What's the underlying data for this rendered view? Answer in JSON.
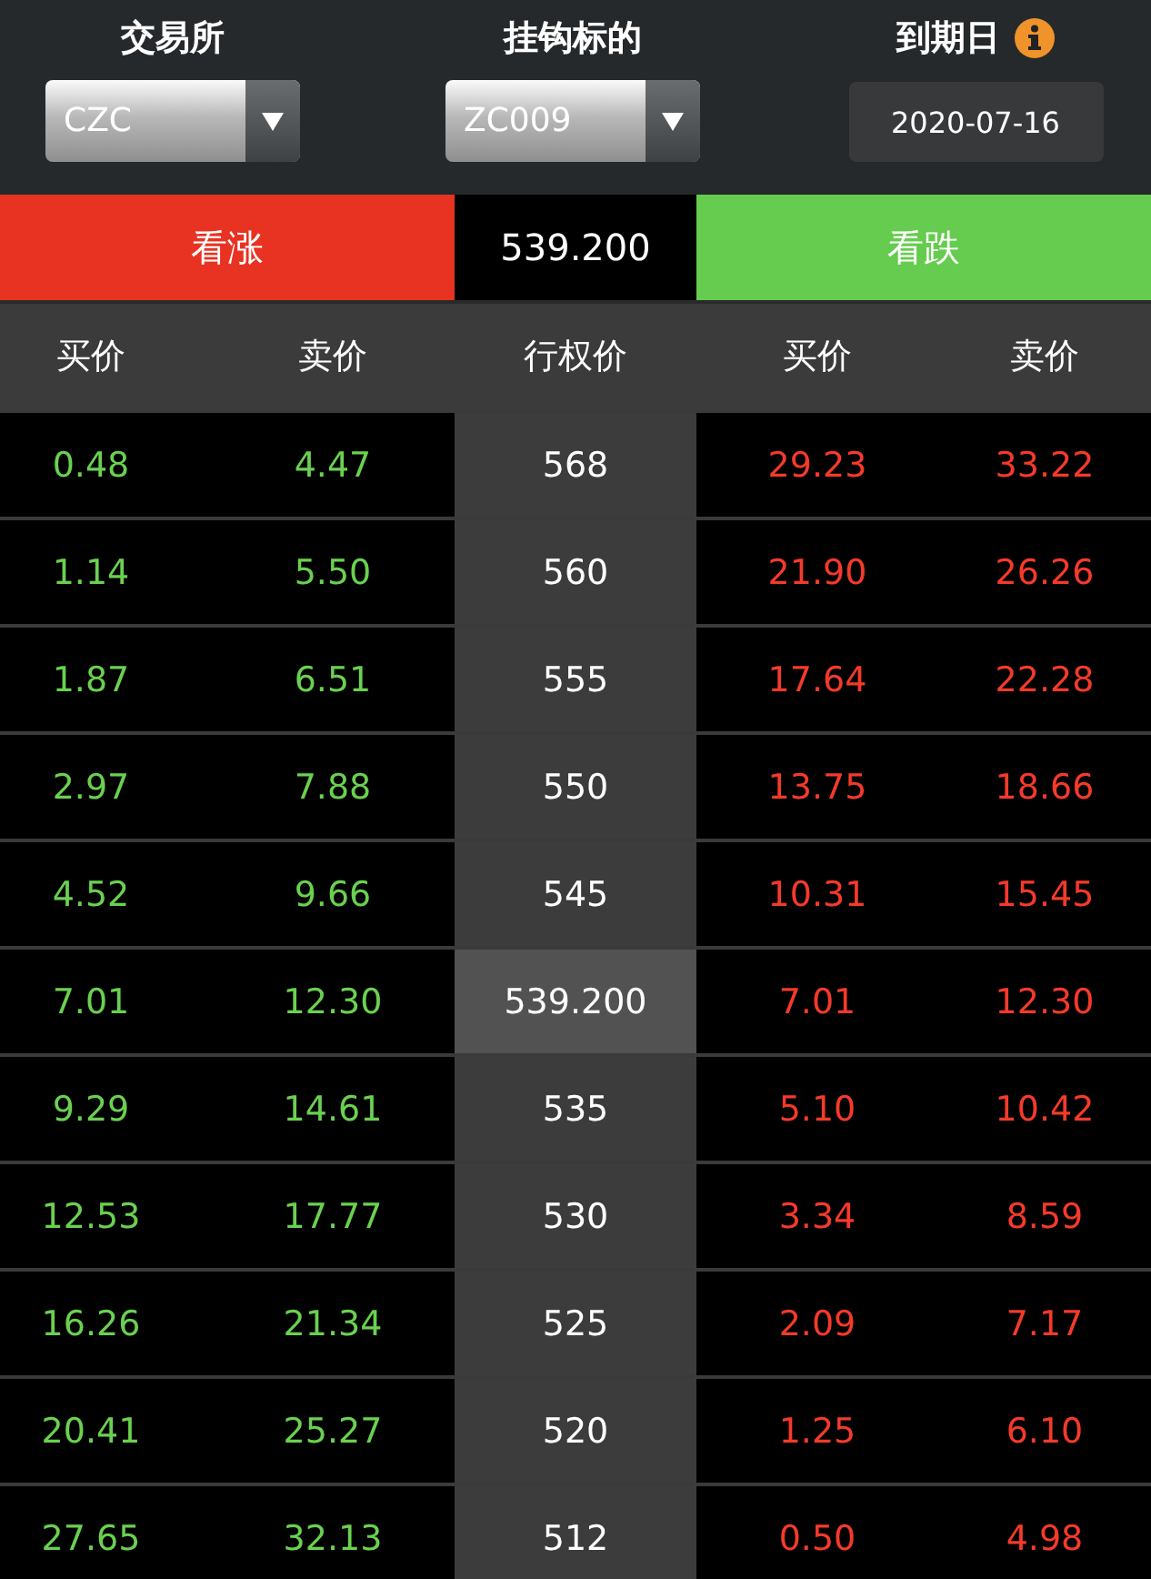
{
  "filters": [
    {
      "label": "交易所",
      "kind": "dropdown",
      "value": "CZC"
    },
    {
      "label": "挂钩标的",
      "kind": "dropdown",
      "value": "ZC009"
    },
    {
      "label": "到期日",
      "kind": "date",
      "value": "2020-07-16",
      "info": true
    }
  ],
  "sides": {
    "call": "看涨",
    "underlying_price": "539.200",
    "put": "看跌"
  },
  "columns": [
    "买价",
    "卖价",
    "行权价",
    "买价",
    "卖价"
  ],
  "rows": [
    {
      "call_bid": "0.48",
      "call_ask": "4.47",
      "strike": "568",
      "put_bid": "29.23",
      "put_ask": "33.22",
      "selected": false
    },
    {
      "call_bid": "1.14",
      "call_ask": "5.50",
      "strike": "560",
      "put_bid": "21.90",
      "put_ask": "26.26",
      "selected": false
    },
    {
      "call_bid": "1.87",
      "call_ask": "6.51",
      "strike": "555",
      "put_bid": "17.64",
      "put_ask": "22.28",
      "selected": false
    },
    {
      "call_bid": "2.97",
      "call_ask": "7.88",
      "strike": "550",
      "put_bid": "13.75",
      "put_ask": "18.66",
      "selected": false
    },
    {
      "call_bid": "4.52",
      "call_ask": "9.66",
      "strike": "545",
      "put_bid": "10.31",
      "put_ask": "15.45",
      "selected": false
    },
    {
      "call_bid": "7.01",
      "call_ask": "12.30",
      "strike": "539.200",
      "put_bid": "7.01",
      "put_ask": "12.30",
      "selected": true
    },
    {
      "call_bid": "9.29",
      "call_ask": "14.61",
      "strike": "535",
      "put_bid": "5.10",
      "put_ask": "10.42",
      "selected": false
    },
    {
      "call_bid": "12.53",
      "call_ask": "17.77",
      "strike": "530",
      "put_bid": "3.34",
      "put_ask": "8.59",
      "selected": false
    },
    {
      "call_bid": "16.26",
      "call_ask": "21.34",
      "strike": "525",
      "put_bid": "2.09",
      "put_ask": "7.17",
      "selected": false
    },
    {
      "call_bid": "20.41",
      "call_ask": "25.27",
      "strike": "520",
      "put_bid": "1.25",
      "put_ask": "6.10",
      "selected": false
    },
    {
      "call_bid": "27.65",
      "call_ask": "32.13",
      "strike": "512",
      "put_bid": "0.50",
      "put_ask": "4.98",
      "selected": false
    }
  ]
}
